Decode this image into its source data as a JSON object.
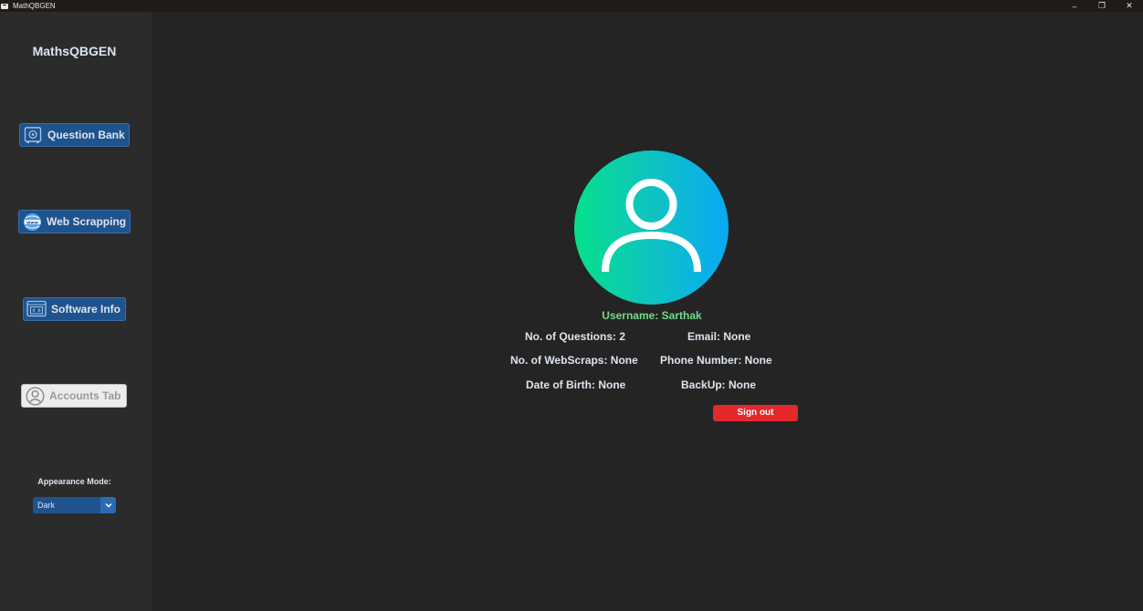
{
  "window": {
    "title": "MathQBGEN",
    "controls": {
      "minimize": "–",
      "restore": "❐",
      "close": "✕"
    }
  },
  "sidebar": {
    "brand": "MathsQBGEN",
    "items": [
      {
        "label": "Question Bank",
        "icon": "safe-icon"
      },
      {
        "label": "Web Scrapping",
        "icon": "www-globe-icon"
      },
      {
        "label": "Software Info",
        "icon": "code-window-icon"
      },
      {
        "label": "Accounts Tab",
        "icon": "user-circle-icon"
      }
    ],
    "appearance": {
      "label": "Appearance Mode:",
      "selected": "Dark"
    }
  },
  "profile": {
    "username": "Username: Sarthak",
    "questions": "No. of Questions: 2",
    "email": "Email: None",
    "webscraps": "No. of WebScraps: None",
    "phone": "Phone Number: None",
    "dob": "Date of Birth: None",
    "backup": "BackUp: None",
    "signout_label": "Sign out"
  },
  "colors": {
    "accent": "#1f538d",
    "signout": "#e3292b",
    "username": "#74d98a",
    "background": "#242424",
    "sidebar": "#2b2b2b"
  }
}
